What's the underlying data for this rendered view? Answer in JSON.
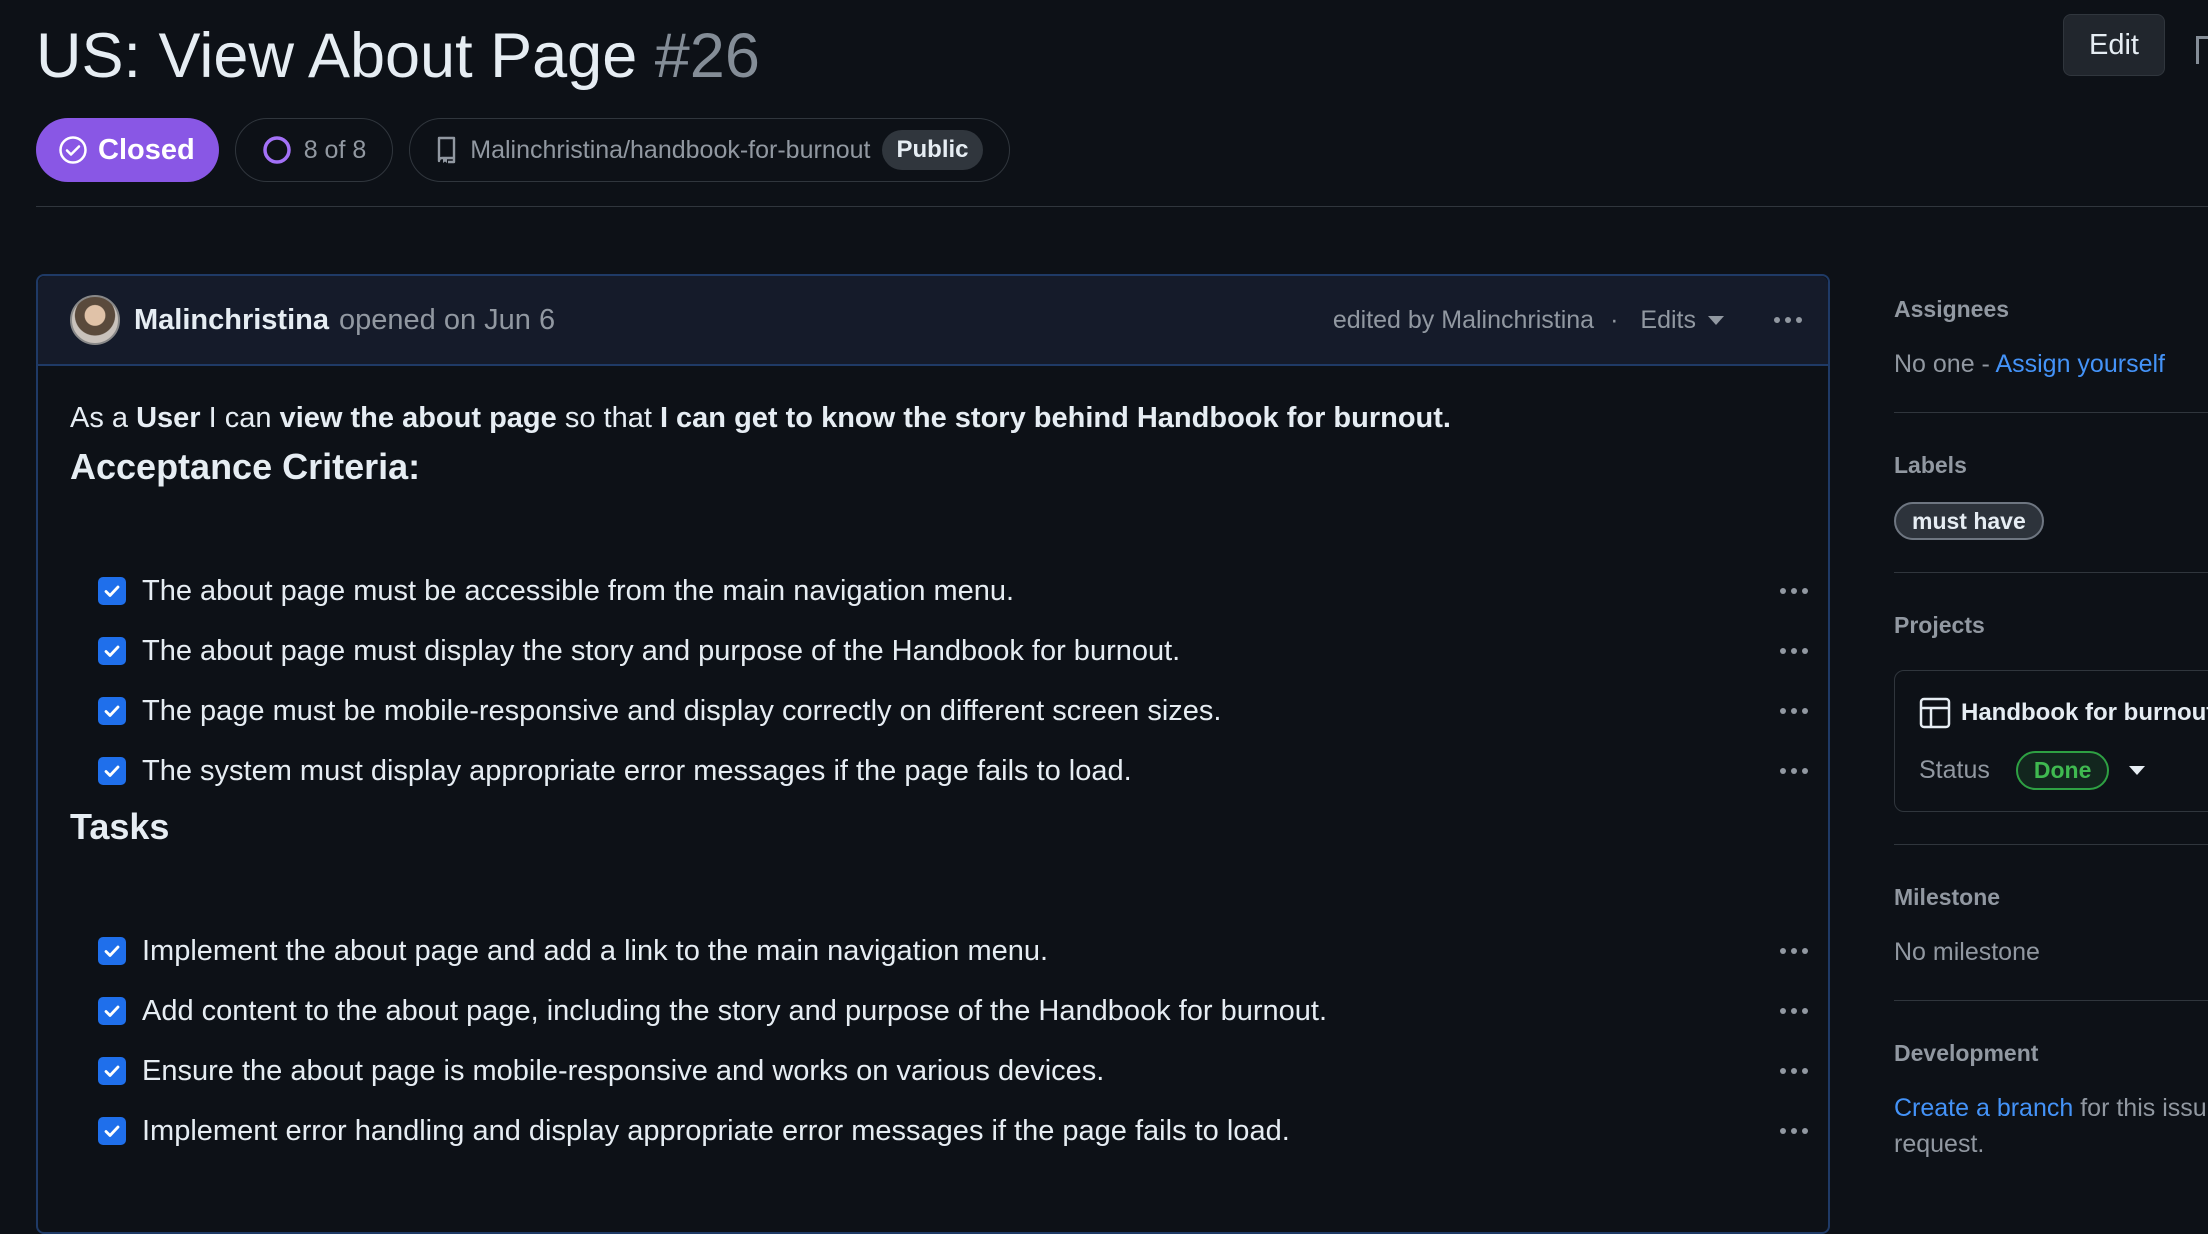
{
  "issue": {
    "title": "US: View About Page",
    "number": "#26",
    "edit_label": "Edit"
  },
  "meta": {
    "status": "Closed",
    "progress": "8 of 8",
    "repo": "Malinchristina/handbook-for-burnout",
    "visibility": "Public"
  },
  "comment": {
    "author": "Malinchristina",
    "opened": "opened on Jun 6",
    "edited_by": "edited by Malinchristina",
    "dot": "·",
    "edits_label": "Edits",
    "story": {
      "p1": "As a ",
      "b1": "User",
      "p2": " I can ",
      "b2": "view the about page",
      "p3": " so that ",
      "b3": "I can get to know the story behind Handbook for burnout."
    },
    "acceptance_heading": "Acceptance Criteria:",
    "acceptance": [
      "The about page must be accessible from the main navigation menu.",
      "The about page must display the story and purpose of the Handbook for burnout.",
      "The page must be mobile-responsive and display correctly on different screen sizes.",
      "The system must display appropriate error messages if the page fails to load."
    ],
    "tasks_heading": "Tasks",
    "tasks": [
      "Implement the about page and add a link to the main navigation menu.",
      "Add content to the about page, including the story and purpose of the Handbook for burnout.",
      "Ensure the about page is mobile-responsive and works on various devices.",
      "Implement error handling and display appropriate error messages if the page fails to load."
    ]
  },
  "sidebar": {
    "assignees_label": "Assignees",
    "assignees_none": "No one - ",
    "assign_yourself": "Assign yourself",
    "labels_label": "Labels",
    "label_tag": "must have",
    "projects_label": "Projects",
    "project_name": "Handbook for burnout",
    "status_label": "Status",
    "status_value": "Done",
    "milestone_label": "Milestone",
    "milestone_value": "No milestone",
    "development_label": "Development",
    "create_branch": "Create a branch",
    "dev_text": " for this issu",
    "dev_text2": "request."
  },
  "colors": {
    "closed": "#8957e5",
    "link": "#4493f8",
    "done": "#3fb950",
    "checkbox": "#1f6feb"
  },
  "icons": [
    "check-circle-icon",
    "progress-circle-icon",
    "repo-icon",
    "chevron-down-icon",
    "kebab-icon",
    "checkbox-checked-icon",
    "table-icon"
  ]
}
